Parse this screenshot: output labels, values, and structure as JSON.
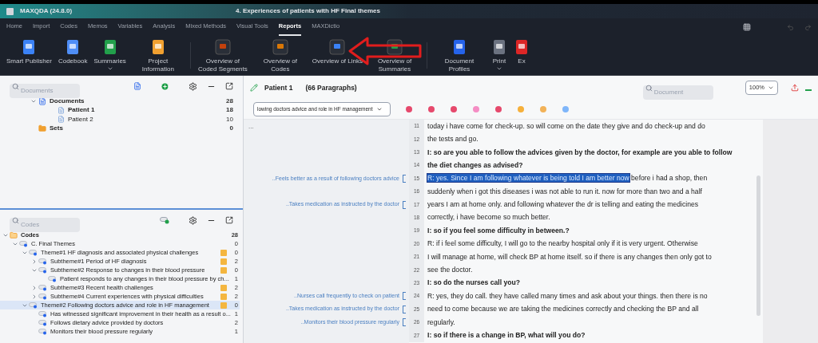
{
  "window": {
    "app_title": "MAXQDA (24.8.0)",
    "title": "4. Experiences of patients with HF Final themes"
  },
  "menu_tabs": [
    {
      "label": "Home",
      "selected": false
    },
    {
      "label": "Import",
      "selected": false
    },
    {
      "label": "Codes",
      "selected": false
    },
    {
      "label": "Memos",
      "selected": false
    },
    {
      "label": "Variables",
      "selected": false
    },
    {
      "label": "Analysis",
      "selected": false
    },
    {
      "label": "Mixed Methods",
      "selected": false
    },
    {
      "label": "Visual Tools",
      "selected": false
    },
    {
      "label": "Reports",
      "selected": true
    },
    {
      "label": "MAXDictio",
      "selected": false
    }
  ],
  "ribbon": [
    {
      "label": "Smart Publisher"
    },
    {
      "label": "Codebook"
    },
    {
      "label": "Summaries",
      "dropdown": true
    },
    {
      "label": "Project Information"
    },
    {
      "label": "Overview of Coded Segments"
    },
    {
      "label": "Overview of Codes"
    },
    {
      "label": "Overview of Links"
    },
    {
      "label": "Overview of Summaries"
    },
    {
      "label": "Document Profiles"
    },
    {
      "label": "Print",
      "dropdown": true
    },
    {
      "label": "Ex"
    }
  ],
  "documents_pane": {
    "search": {
      "placeholder": "Documents"
    },
    "tree": [
      {
        "label": "Documents",
        "count": "28",
        "bold": true,
        "expanded": true,
        "kind": "root",
        "children": [
          {
            "label": "Patient 1",
            "count": "18",
            "bold": true,
            "kind": "document"
          },
          {
            "label": "Patient 2",
            "count": "10",
            "bold": false,
            "kind": "document"
          }
        ]
      },
      {
        "label": "Sets",
        "count": "0",
        "bold": true,
        "kind": "sets"
      }
    ]
  },
  "codes_pane": {
    "search": {
      "placeholder": "Codes"
    },
    "tree": [
      {
        "label": "Codes",
        "count": "28",
        "expanded": true,
        "memo": false,
        "selected": false,
        "children": [
          {
            "label": "C. Final Themes",
            "count": "0",
            "expanded": true,
            "memo": false,
            "selected": false,
            "children": [
              {
                "label": "Theme#1 HF diagnosis and associated physical challenges",
                "count": "0",
                "expanded": true,
                "memo": true,
                "selected": false,
                "children": [
                  {
                    "label": "Subtheme#1 Period of HF diagnosis",
                    "count": "2",
                    "expanded": false,
                    "memo": true,
                    "selected": false
                  },
                  {
                    "label": "Subtheme#2 Response to changes in their blood pressure",
                    "count": "0",
                    "expanded": true,
                    "memo": true,
                    "selected": false,
                    "children": [
                      {
                        "label": "Patient responds to any changes in their blood pressure by ch...",
                        "count": "1",
                        "memo": false,
                        "selected": false
                      }
                    ]
                  },
                  {
                    "label": "Subtheme#3 Recent health challenges",
                    "count": "2",
                    "expanded": false,
                    "memo": true,
                    "selected": false
                  },
                  {
                    "label": "Subtheme#4 Current experiences with physical difficulties",
                    "count": "2",
                    "expanded": false,
                    "memo": true,
                    "selected": false
                  }
                ]
              },
              {
                "label": "Theme#2 Following doctors advice and role in HF management",
                "count": "0",
                "expanded": true,
                "memo": true,
                "selected": true,
                "children": [
                  {
                    "label": "Has witnessed significant improvement in their health as a result o...",
                    "count": "1",
                    "memo": false,
                    "selected": false
                  },
                  {
                    "label": "Follows dietary advice provided by doctors",
                    "count": "2",
                    "memo": false,
                    "selected": false
                  },
                  {
                    "label": "Monitors their blood pressure regularly",
                    "count": "1",
                    "memo": false,
                    "selected": false
                  }
                ]
              }
            ]
          }
        ]
      }
    ]
  },
  "document_browser": {
    "title": "Patient 1",
    "subtitle": "(66 Paragraphs)",
    "search": {
      "placeholder": "Document"
    },
    "zoom": "100%",
    "code_select": "lowing doctors advice and role in HF management",
    "margin_menu": "...",
    "lines": [
      {
        "number": "11",
        "text": "today i have come for check-up. so will come on the date they give and do check-up and do",
        "bold": false
      },
      {
        "number": "12",
        "text": "the tests and go.",
        "bold": false
      },
      {
        "number": "13",
        "text": "I: so are you able to follow the advices given by the doctor, for example are you able to follow",
        "bold": true
      },
      {
        "number": "14",
        "text": "the diet changes as advised?",
        "bold": true
      },
      {
        "number": "15",
        "selection": "R: yes. Since I am following whatever is being told I am better now",
        "text": " before i had a shop, then",
        "bold": false,
        "margin_codes": [
          "..Feels better as a result of following doctors advice"
        ]
      },
      {
        "number": "16",
        "text": "suddenly when i got this diseases i was not able to run it. now for more than two and a half",
        "bold": false
      },
      {
        "number": "17",
        "text": "years I am at home only. and following whatever the dr is telling and eating the medicines",
        "bold": false,
        "margin_codes": [
          "..Takes medication as instructed by the doctor"
        ]
      },
      {
        "number": "18",
        "text": "correctly, i have become so much better.",
        "bold": false
      },
      {
        "number": "19",
        "text": "I: so if you feel some difficulty in between.?",
        "bold": true
      },
      {
        "number": "20",
        "text": "R: if i feel some difficulty, I will go to the nearby hospital only if it is very urgent. Otherwise",
        "bold": false
      },
      {
        "number": "21",
        "text": "I will manage at home, will check BP at home itself. so if there is any changes then only got to",
        "bold": false
      },
      {
        "number": "22",
        "text": "see the doctor.",
        "bold": false
      },
      {
        "number": "23",
        "text": "I: so do the nurses call you?",
        "bold": true
      },
      {
        "number": "24",
        "text": "R: yes, they do call. they have called many times and ask about your things. then there is no",
        "bold": false,
        "margin_codes": [
          "..Nurses call frequently to check on patient"
        ]
      },
      {
        "number": "25",
        "text": "need to come because we are taking the medicines correctly and checking the BP and all",
        "bold": false,
        "margin_codes": [
          "..Takes medication as instructed by the doctor"
        ]
      },
      {
        "number": "26",
        "text": "regularly.",
        "bold": false,
        "margin_codes": [
          "..Monitors their blood pressure regularly"
        ]
      },
      {
        "number": "27",
        "text": "I: so if there is a change in BP, what will you do?",
        "bold": true
      }
    ]
  }
}
